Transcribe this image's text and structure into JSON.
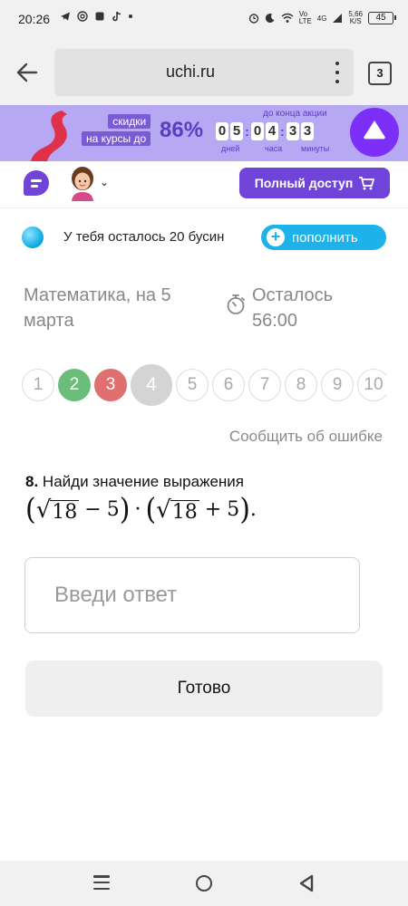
{
  "status_bar": {
    "time": "20:26",
    "battery": "45",
    "net_speed": "5,66",
    "net_unit": "K/S",
    "net_type": "4G",
    "volte": "Vo LTE"
  },
  "browser": {
    "url": "uchi.ru",
    "tab_count": "3"
  },
  "promo": {
    "tag_line1": "скидки",
    "tag_line2": "на курсы до",
    "percent": "86%",
    "countdown_title": "до конца акции",
    "days": [
      "0",
      "5"
    ],
    "hours": [
      "0",
      "4"
    ],
    "minutes": [
      "3",
      "3"
    ],
    "label_days": "дней",
    "label_hours": "часа",
    "label_minutes": "минуты"
  },
  "header": {
    "full_access_label": "Полный доступ"
  },
  "beads": {
    "text": "У тебя осталось 20 бусин",
    "refill_label": "пополнить"
  },
  "lesson": {
    "title": "Математика, на 5 марта",
    "timer_label": "Осталось",
    "timer_value": "56:00"
  },
  "pager": {
    "pages": [
      {
        "label": "1",
        "state": "default"
      },
      {
        "label": "2",
        "state": "done-green"
      },
      {
        "label": "3",
        "state": "done-red"
      },
      {
        "label": "4",
        "state": "current"
      },
      {
        "label": "5",
        "state": "default"
      },
      {
        "label": "6",
        "state": "default"
      },
      {
        "label": "7",
        "state": "default"
      },
      {
        "label": "8",
        "state": "default"
      },
      {
        "label": "9",
        "state": "default"
      },
      {
        "label": "10",
        "state": "default"
      }
    ]
  },
  "report_link": "Сообщить об ошибке",
  "task": {
    "number": "8.",
    "prompt": "Найди значение выражения",
    "radicand1": "18",
    "op1": "−",
    "num1": "5",
    "dot": "·",
    "radicand2": "18",
    "op2": "+",
    "num2": "5",
    "end": "."
  },
  "answer": {
    "placeholder": "Введи ответ"
  },
  "done_label": "Готово",
  "colors": {
    "accent_purple": "#7044d8",
    "promo_bg": "#b7a8f4",
    "refill_blue": "#1eb2ea",
    "green": "#6cbc7b",
    "red": "#e07070"
  }
}
